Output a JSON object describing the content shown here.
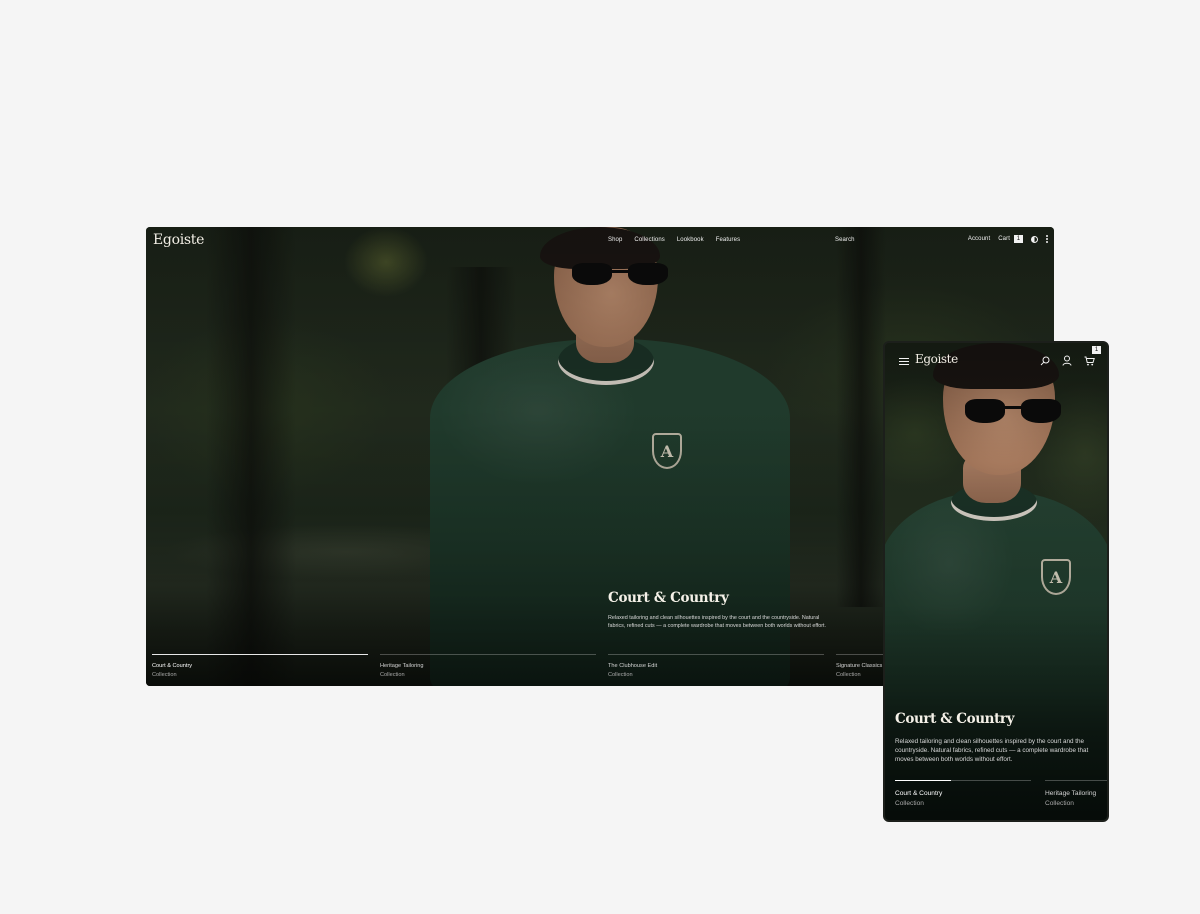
{
  "brand": {
    "name": "Egoiste"
  },
  "desktop": {
    "nav": [
      "Shop",
      "Collections",
      "Lookbook",
      "Features"
    ],
    "search_label": "Search",
    "account_label": "Account",
    "cart_label": "Cart",
    "cart_count": "1"
  },
  "mobile": {
    "cart_count": "1"
  },
  "hero": {
    "title": "Court & Country",
    "description": "Relaxed tailoring and clean silhouettes inspired by the court and the countryside. Natural fabrics, refined cuts — a complete wardrobe that moves between both worlds without effort."
  },
  "collections": [
    {
      "name": "Court & Country",
      "sub": "Collection"
    },
    {
      "name": "Heritage Tailoring",
      "sub": "Collection"
    },
    {
      "name": "The Clubhouse Edit",
      "sub": "Collection"
    },
    {
      "name": "Signature Classics",
      "sub": "Collection"
    }
  ],
  "crest_letter": "A",
  "icons": [
    "contrast-icon",
    "kebab-icon",
    "hamburger-icon",
    "search-icon",
    "account-icon",
    "cart-icon"
  ],
  "colors": {
    "page_background": "#f5f5f5",
    "sweater_green": "#1f3a2b",
    "text": "#ffffff"
  }
}
